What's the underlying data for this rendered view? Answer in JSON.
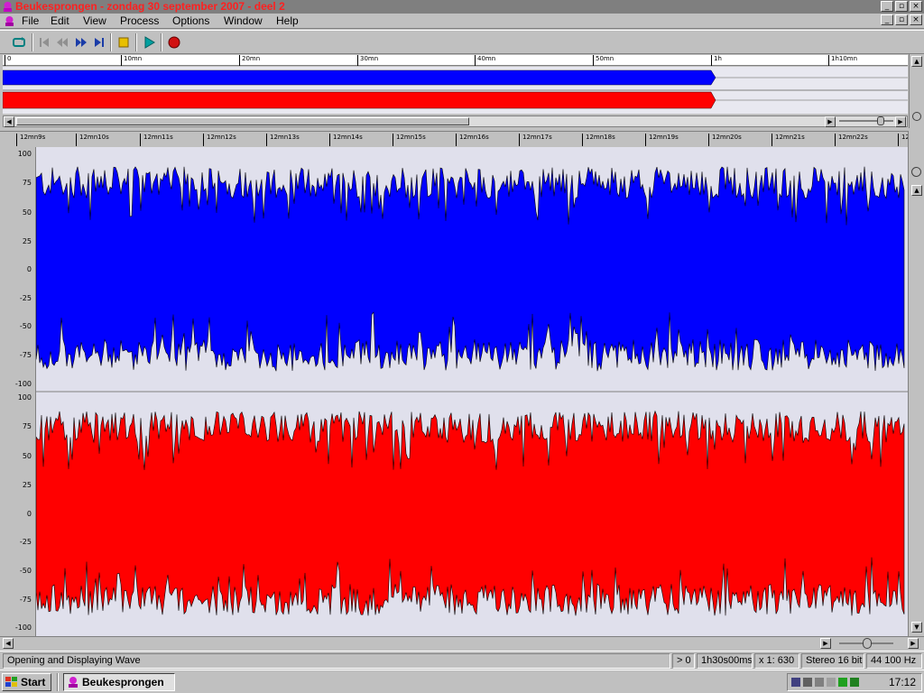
{
  "window": {
    "title": "Beukesprongen - zondag 30 september 2007 - deel 2"
  },
  "menu": [
    "File",
    "Edit",
    "View",
    "Process",
    "Options",
    "Window",
    "Help"
  ],
  "toolbar": {
    "buttons": [
      "loop-icon",
      "go-start-icon",
      "rewind-icon",
      "fast-forward-icon",
      "go-end-icon",
      "stop-icon",
      "play-icon",
      "record-icon"
    ]
  },
  "overview": {
    "ruler_labels": [
      "0",
      "10mn",
      "20mn",
      "30mn",
      "40mn",
      "50mn",
      "1h",
      "1h10mn"
    ],
    "colors": {
      "left": "#0000ff",
      "right": "#ff0000"
    }
  },
  "main": {
    "ruler_labels": [
      "12mn9s",
      "12mn10s",
      "12mn11s",
      "12mn12s",
      "12mn13s",
      "12mn14s",
      "12mn15s",
      "12mn16s",
      "12mn17s",
      "12mn18s",
      "12mn19s",
      "12mn20s",
      "12mn21s",
      "12mn22s",
      "12"
    ],
    "y_labels_top": [
      "100",
      "75",
      "50",
      "25",
      "0",
      "-25",
      "-50",
      "-75",
      "-100"
    ],
    "y_labels_bottom": [
      "100",
      "75",
      "50",
      "25",
      "0",
      "-25",
      "-50",
      "-75",
      "-100"
    ],
    "colors": {
      "left": "#0000ff",
      "right": "#ff0000",
      "background": "#e0e0ec"
    }
  },
  "status": {
    "message": "Opening and Displaying Wave",
    "position": "> 0",
    "duration": "1h30s00ms",
    "zoom": "x 1: 630",
    "format": "Stereo 16 bit",
    "rate": "44 100 Hz"
  },
  "taskbar": {
    "start": "Start",
    "task": "Beukesprongen",
    "clock": "17:12"
  }
}
